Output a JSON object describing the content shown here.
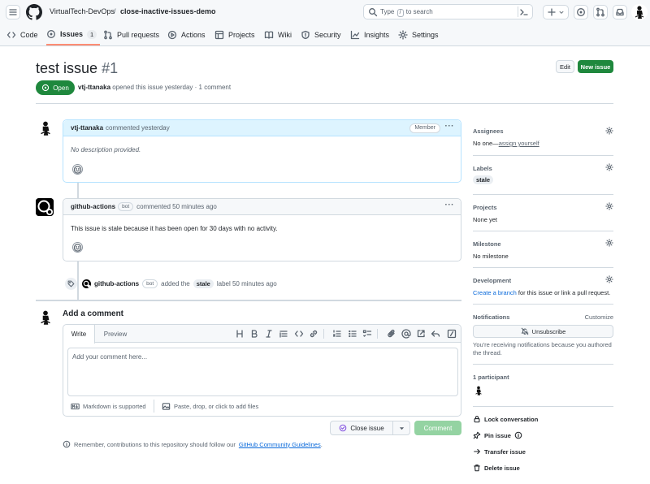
{
  "repo": {
    "owner": "VirtualTech-DevOps",
    "separator": "/",
    "name": "close-inactive-issues-demo"
  },
  "search": {
    "prefix": "Type",
    "key": "/",
    "suffix": "to search"
  },
  "tabs": [
    {
      "label": "Code"
    },
    {
      "label": "Issues",
      "count": "1"
    },
    {
      "label": "Pull requests"
    },
    {
      "label": "Actions"
    },
    {
      "label": "Projects"
    },
    {
      "label": "Wiki"
    },
    {
      "label": "Security"
    },
    {
      "label": "Insights"
    },
    {
      "label": "Settings"
    }
  ],
  "issue": {
    "title": "test issue",
    "number": "#1",
    "state": "Open",
    "author": "vtj-ttanaka",
    "meta": "opened this issue yesterday · 1 comment",
    "edit_label": "Edit",
    "new_issue_label": "New issue"
  },
  "comments": [
    {
      "author": "vtj-ttanaka",
      "action": "commented yesterday",
      "role": "Member",
      "body": "No description provided."
    },
    {
      "author": "github-actions",
      "bot": "bot",
      "action": "commented 50 minutes ago",
      "body": "This issue is stale because it has been open for 30 days with no activity."
    }
  ],
  "event": {
    "actor": "github-actions",
    "bot": "bot",
    "pre": "added the",
    "label": "stale",
    "post": "label 50 minutes ago"
  },
  "add_comment": {
    "heading": "Add a comment",
    "tab_write": "Write",
    "tab_preview": "Preview",
    "placeholder": "Add your comment here...",
    "markdown_note": "Markdown is supported",
    "attach_note": "Paste, drop, or click to add files",
    "close_issue": "Close issue",
    "comment_btn": "Comment",
    "guidelines_pre": "Remember, contributions to this repository should follow our",
    "guidelines_link": "GitHub Community Guidelines",
    "guidelines_post": "."
  },
  "sidebar": {
    "assignees": {
      "heading": "Assignees",
      "value_pre": "No one—",
      "value_link": "assign yourself"
    },
    "labels": {
      "heading": "Labels",
      "value": "stale"
    },
    "projects": {
      "heading": "Projects",
      "value": "None yet"
    },
    "milestone": {
      "heading": "Milestone",
      "value": "No milestone"
    },
    "development": {
      "heading": "Development",
      "link": "Create a branch",
      "text": " for this issue or link a pull request."
    },
    "notifications": {
      "heading": "Notifications",
      "customize": "Customize",
      "button": "Unsubscribe",
      "note": "You're receiving notifications because you authored the thread."
    },
    "participants": {
      "heading": "1 participant"
    },
    "actions": [
      {
        "label": "Lock conversation",
        "icon": "lock-icon"
      },
      {
        "label": "Pin issue",
        "icon": "pin-icon"
      },
      {
        "label": "Transfer issue",
        "icon": "arrow-right-icon"
      },
      {
        "label": "Delete issue",
        "icon": "trash-icon"
      }
    ]
  },
  "colors": {
    "green": "#1f883d",
    "blue": "#0969da",
    "tab_underline": "#fd8c73",
    "comment_header": "#ddf4ff"
  }
}
